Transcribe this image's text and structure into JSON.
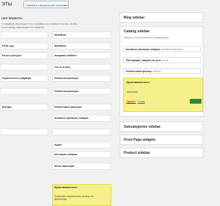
{
  "header": {
    "title": "ЭТЫ",
    "customize_label": "Перейти к визуальной настройке"
  },
  "available": {
    "title": "ные виджеты",
    "desc_1": "и сайдбара, перетащите его в сайдбар или кликните на нем. Чтобы",
    "desc_2": "ть его назад, перетащите его обратно."
  },
  "widgets": [
    {
      "label": "",
      "col": "left"
    },
    {
      "label": "MetaSlider",
      "col": "right"
    },
    {
      "label": "HTML-код",
      "col": "left"
    },
    {
      "label": "MetaSlider",
      "col": "right"
    },
    {
      "label": "Recent post grid",
      "col": "left"
    },
    {
      "label": "Инициалы Мойбот",
      "col": "right"
    },
    {
      "label": "",
      "col": "left"
    },
    {
      "label": "List of rtl item",
      "col": "right"
    },
    {
      "label": "Ограничитель сайдбара",
      "col": "left"
    },
    {
      "label": "Рейтингом фильтры",
      "col": "right"
    },
    {
      "label": "",
      "col": "left"
    },
    {
      "label": "Рейтингом фильтры",
      "col": "right"
    },
    {
      "label": "Бренды",
      "col": "left"
    },
    {
      "label": "Рейтинговые фильтры",
      "col": "right"
    },
    {
      "label": "Активные фильтры товаров",
      "col": "right"
    },
    {
      "label": "",
      "col": "left"
    },
    {
      "label": "",
      "col": "right"
    },
    {
      "label": "Аудио",
      "col": "right"
    },
    {
      "label": "Категории товаров",
      "col": "right"
    },
    {
      "label": "Меню навигации",
      "col": "right"
    },
    {
      "label": "Мультивалютность",
      "col": "right",
      "highlight": true
    }
  ],
  "sidebars": {
    "blog": {
      "title": "Blog sidebar"
    },
    "catalog": {
      "title": "Catalog sidebar",
      "desc": "Sidebar on WooCommerce Catalog pages",
      "items": [
        {
          "label": "Активные фильтры товаров:",
          "value": "Активные фильтры"
        },
        {
          "label": "Фильтрация товаров по цене:",
          "value": "Цена"
        },
        {
          "label": "Рейтинговый фильтр:",
          "value": "Фильтр"
        }
      ],
      "expanded": {
        "title": "Мультивалютность",
        "subtitle": "Заголовок",
        "delete": "Удалить",
        "close": "Готово"
      }
    },
    "subcategories": {
      "title": "Subcategories sidebar"
    },
    "front": {
      "title": "Front Page widgets"
    },
    "product": {
      "title": "Product sidebar"
    }
  },
  "bottom_desc": {
    "line1": "Позволяет переключать валюту на",
    "line2": "фронтенде"
  }
}
